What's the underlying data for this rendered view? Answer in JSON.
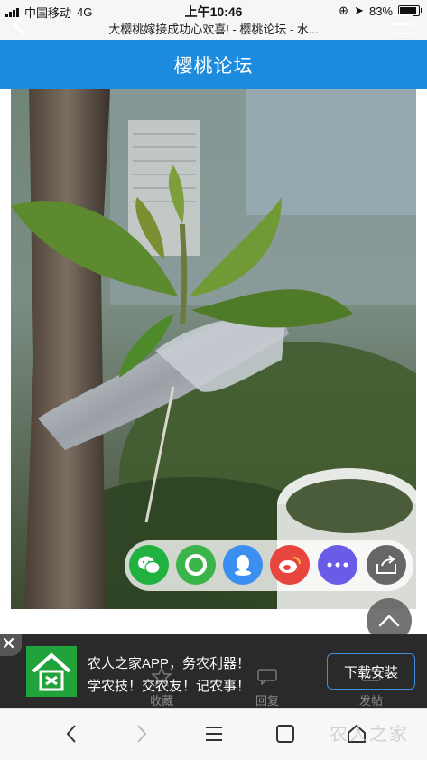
{
  "status": {
    "carrier": "中国移动",
    "network": "4G",
    "time": "上午10:46",
    "battery": "83%"
  },
  "url_title": "大樱桃嫁接成功心欢喜! - 樱桃论坛 - 水...",
  "header": {
    "title": "樱桃论坛",
    "back_icon": "chevron-left-icon",
    "menu_icon": "menu-icon"
  },
  "share_bar": {
    "items": [
      "wechat-icon",
      "moments-icon",
      "qq-icon",
      "weibo-icon",
      "more-icon",
      "share-icon"
    ]
  },
  "ad": {
    "line1": "农人之家APP，务农利器！",
    "line2": "学农技！交农友！记农事！",
    "button": "下载安装",
    "logo": "农人之家"
  },
  "hidden_bar": {
    "fav": "收藏",
    "reply": "回复",
    "post": "发帖"
  },
  "watermark": "农人之家",
  "colors": {
    "header": "#1e8cde",
    "ad_bg": "#2a2a2a"
  }
}
